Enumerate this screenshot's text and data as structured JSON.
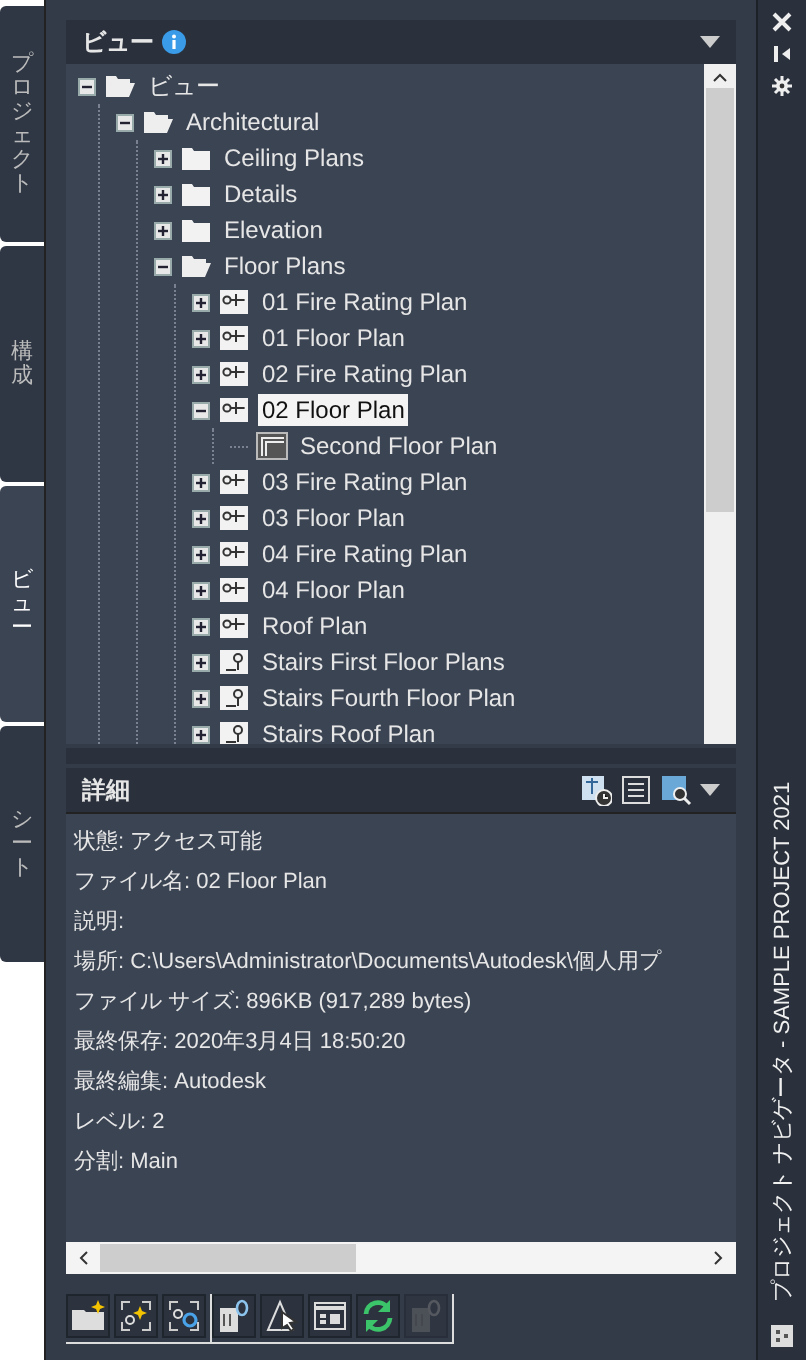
{
  "side_tabs": [
    {
      "label": "プロジェクト",
      "selected": false
    },
    {
      "label": "構成",
      "selected": false
    },
    {
      "label": "ビュー",
      "selected": true
    },
    {
      "label": "シート",
      "selected": false
    }
  ],
  "views_panel": {
    "title": "ビュー",
    "tree": [
      {
        "label": "ビュー",
        "kind": "folder",
        "expanded": true,
        "selected": false,
        "children": [
          {
            "label": "Architectural",
            "kind": "folder",
            "expanded": true,
            "selected": false,
            "children": [
              {
                "label": "Ceiling Plans",
                "kind": "folder",
                "expanded": false,
                "selected": false
              },
              {
                "label": "Details",
                "kind": "folder",
                "expanded": false,
                "selected": false
              },
              {
                "label": "Elevation",
                "kind": "folder",
                "expanded": false,
                "selected": false
              },
              {
                "label": "Floor Plans",
                "kind": "folder",
                "expanded": true,
                "selected": false,
                "children": [
                  {
                    "label": "01 Fire Rating Plan",
                    "kind": "view",
                    "expanded": false,
                    "selected": false
                  },
                  {
                    "label": "01 Floor Plan",
                    "kind": "view",
                    "expanded": false,
                    "selected": false
                  },
                  {
                    "label": "02 Fire Rating Plan",
                    "kind": "view",
                    "expanded": false,
                    "selected": false
                  },
                  {
                    "label": "02 Floor Plan",
                    "kind": "view",
                    "expanded": true,
                    "selected": true,
                    "children": [
                      {
                        "label": "Second Floor Plan",
                        "kind": "model-view",
                        "selected": false
                      }
                    ]
                  },
                  {
                    "label": "03 Fire Rating Plan",
                    "kind": "view",
                    "expanded": false,
                    "selected": false
                  },
                  {
                    "label": "03 Floor Plan",
                    "kind": "view",
                    "expanded": false,
                    "selected": false
                  },
                  {
                    "label": "04 Fire Rating Plan",
                    "kind": "view",
                    "expanded": false,
                    "selected": false
                  },
                  {
                    "label": "04 Floor Plan",
                    "kind": "view",
                    "expanded": false,
                    "selected": false
                  },
                  {
                    "label": "Roof Plan",
                    "kind": "view",
                    "expanded": false,
                    "selected": false
                  },
                  {
                    "label": "Stairs First Floor Plans",
                    "kind": "stairs-view",
                    "expanded": false,
                    "selected": false
                  },
                  {
                    "label": "Stairs Fourth Floor Plan",
                    "kind": "stairs-view",
                    "expanded": false,
                    "selected": false
                  },
                  {
                    "label": "Stairs Roof Plan",
                    "kind": "stairs-view",
                    "expanded": false,
                    "selected": false
                  }
                ]
              }
            ]
          }
        ]
      }
    ]
  },
  "details_panel": {
    "title": "詳細",
    "lines": [
      "状態: アクセス可能",
      "ファイル名: 02 Floor Plan",
      "説明:",
      "場所: C:\\Users\\Administrator\\Documents\\Autodesk\\個人用プ",
      "ファイル サイズ: 896KB (917,289 bytes)",
      "最終保存: 2020年3月4日  18:50:20",
      "最終編集: Autodesk",
      "レベル: 2",
      "分割: Main"
    ]
  },
  "toolbar": [
    {
      "kind": "add-category",
      "disabled": false
    },
    {
      "kind": "add-view",
      "disabled": false
    },
    {
      "kind": "view-settings",
      "disabled": false
    },
    {
      "kind": "xref",
      "disabled": false
    },
    {
      "kind": "select",
      "disabled": false
    },
    {
      "kind": "layout",
      "disabled": false
    },
    {
      "kind": "refresh",
      "disabled": false
    },
    {
      "kind": "xref",
      "disabled": true
    }
  ],
  "palette_title": "プロジェクト ナビゲータ - SAMPLE PROJECT 2021"
}
